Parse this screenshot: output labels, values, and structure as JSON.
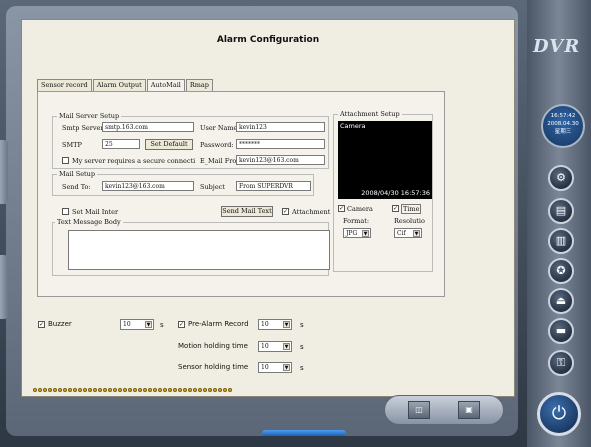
{
  "title": "Alarm Configuration",
  "brand": "DVR",
  "clock": {
    "time": "16:57:42",
    "date": "2008.04.30",
    "weekday": "星期三"
  },
  "tabs": [
    "Sensor record",
    "Alarm Output",
    "AutoMail",
    "Rmap"
  ],
  "active_tab": "AutoMail",
  "mail_server": {
    "group_label": "Mail Server Setup",
    "smtp_server_label": "Smtp Server",
    "smtp_server_value": "smtp.163.com",
    "user_name_label": "User Name:",
    "user_name_value": "kevin123",
    "smtp_label": "SMTP",
    "smtp_port": "25",
    "set_default_label": "Set Default",
    "password_label": "Password:",
    "password_value": "*******",
    "secure_label": "My server requires a secure connecti",
    "email_from_label": "E_Mail From",
    "email_from_value": "kevin123@163.com"
  },
  "mail_setup": {
    "group_label": "Mail Setup",
    "send_to_label": "Send To:",
    "send_to_value": "kevin123@163.com",
    "subject_label": "Subject",
    "subject_value": "From SUPERDVR"
  },
  "set_mail_inter_label": "Set Mail Inter",
  "send_mail_text_label": "Send Mail Text",
  "attachment_label": "Attachment",
  "text_message_label": "Text Message Body",
  "attachment_setup": {
    "group_label": "Attachment Setup",
    "camera_overlay": "Camera",
    "timestamp": "2008/04/30 16:57:36",
    "camera_label": "Camera",
    "time_label": "Time",
    "format_label": "Format:",
    "format_value": "JPG",
    "resolution_label": "Resolutio",
    "resolution_value": "Cif"
  },
  "bottom": {
    "buzzer_label": "Buzzer",
    "buzzer_value": "10",
    "pre_alarm_label": "Pre-Alarm Record",
    "pre_alarm_value": "10",
    "motion_label": "Motion holding time",
    "motion_value": "10",
    "sensor_label": "Sensor holding time",
    "sensor_value": "10",
    "unit": "s"
  },
  "icons": [
    "gear-icon",
    "calendar-icon",
    "film-icon",
    "run-icon",
    "eject-icon",
    "minus-icon",
    "key-icon",
    "power-icon",
    "camera-icon",
    "record-icon"
  ],
  "colors": {
    "panel": "#f0eee2",
    "accent": "#1c5fb4",
    "dots": "#d7b22a"
  }
}
